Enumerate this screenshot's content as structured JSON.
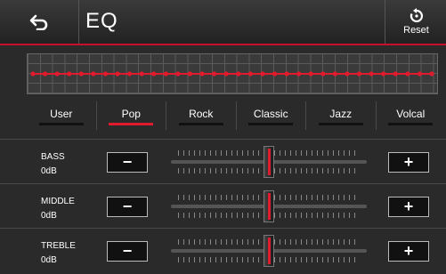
{
  "header": {
    "title": "EQ",
    "reset_label": "Reset"
  },
  "graph": {
    "points": 34
  },
  "presets": [
    {
      "label": "User",
      "active": false
    },
    {
      "label": "Pop",
      "active": true
    },
    {
      "label": "Rock",
      "active": false
    },
    {
      "label": "Classic",
      "active": false
    },
    {
      "label": "Jazz",
      "active": false
    },
    {
      "label": "Volcal",
      "active": false
    }
  ],
  "bands": [
    {
      "name": "BASS",
      "value": "0dB",
      "level": 0.5
    },
    {
      "name": "MIDDLE",
      "value": "0dB",
      "level": 0.5
    },
    {
      "name": "TREBLE",
      "value": "0dB",
      "level": 0.5
    }
  ],
  "buttons": {
    "minus": "−",
    "plus": "+"
  },
  "colors": {
    "accent": "#e01b2e",
    "background": "#2a2a2a"
  }
}
